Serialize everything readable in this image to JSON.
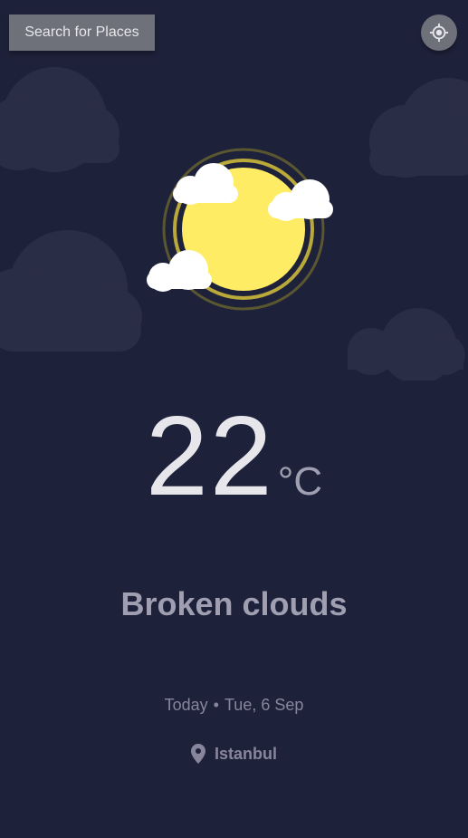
{
  "header": {
    "search_label": "Search for Places",
    "locate_icon": "crosshair-icon"
  },
  "weather": {
    "icon": "sun-with-clouds-icon",
    "temperature": "22",
    "unit": "°C",
    "condition": "Broken clouds",
    "day_label": "Today",
    "separator": "•",
    "date": "Tue, 6 Sep",
    "location_icon": "map-pin-icon",
    "location": "Istanbul"
  },
  "colors": {
    "background": "#1e213a",
    "button": "#6e707a",
    "sun": "#ffec65",
    "primary_text": "#e7e7eb",
    "secondary_text": "#a09fb1",
    "muted_text": "#88869d"
  }
}
